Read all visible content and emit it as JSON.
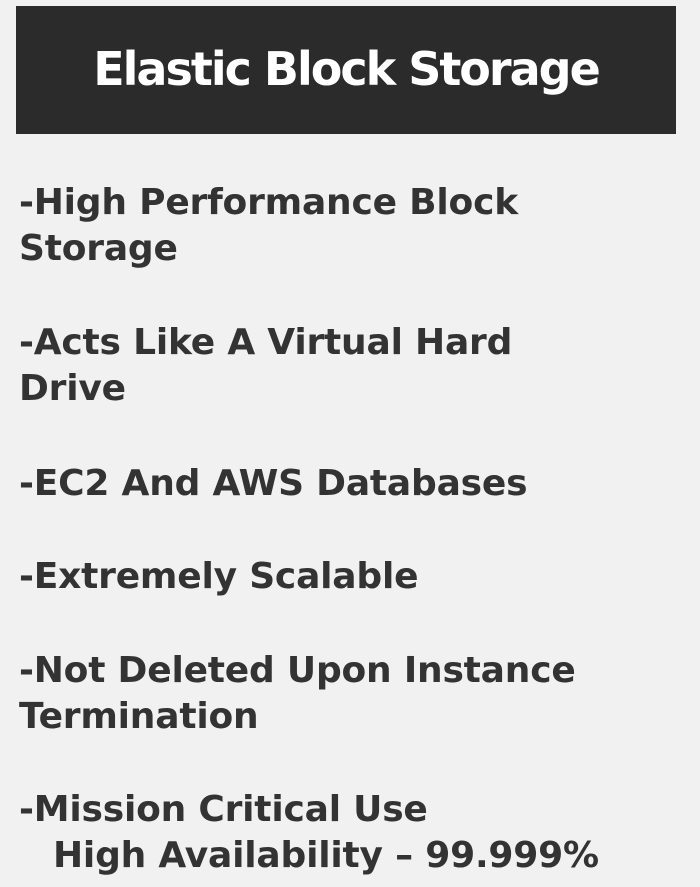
{
  "slide": {
    "title": "Elastic Block Storage",
    "bullets": [
      {
        "lines": [
          "-High Performance Block",
          "Storage"
        ]
      },
      {
        "lines": [
          "-Acts Like A Virtual Hard",
          "Drive"
        ]
      },
      {
        "lines": [
          "-EC2 And AWS Databases"
        ]
      },
      {
        "lines": [
          "-Extremely Scalable"
        ]
      },
      {
        "lines": [
          "-Not Deleted Upon Instance",
          "Termination"
        ]
      },
      {
        "lines": [
          "-Mission Critical Use",
          "High Availability – 99.999%"
        ]
      }
    ]
  }
}
